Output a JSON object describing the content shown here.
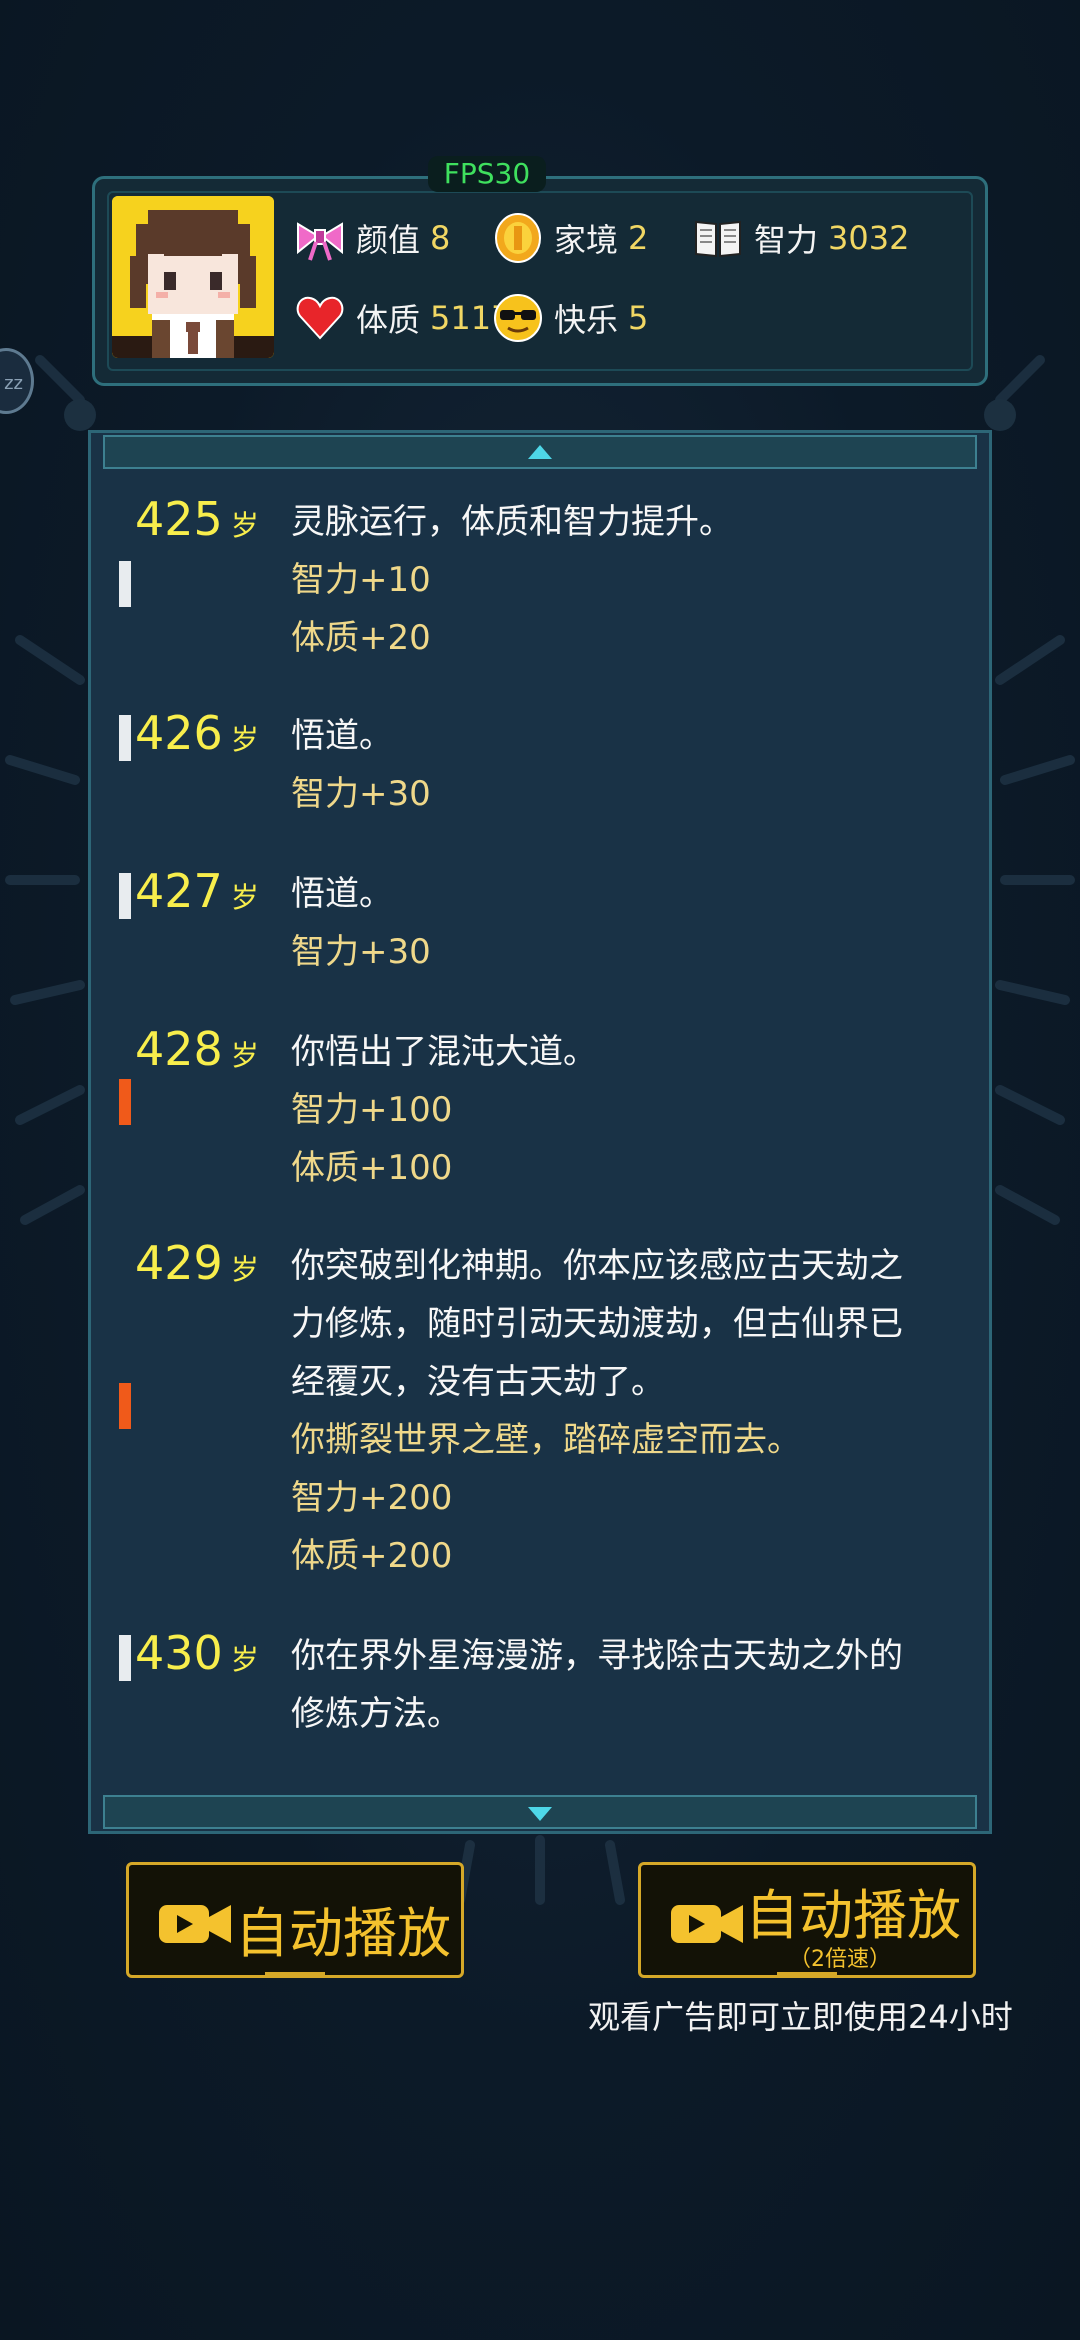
{
  "fps": "FPS30",
  "side_handle": "zz",
  "stats": [
    {
      "icon": "bow-icon",
      "label": "颜值",
      "value": "8"
    },
    {
      "icon": "coin-icon",
      "label": "家境",
      "value": "2"
    },
    {
      "icon": "book-icon",
      "label": "智力",
      "value": "3032"
    },
    {
      "icon": "heart-icon",
      "label": "体质",
      "value": "5117"
    },
    {
      "icon": "sunglasses-emoji-icon",
      "label": "快乐",
      "value": "5"
    }
  ],
  "age_suffix": "岁",
  "entries": [
    {
      "age": "425",
      "marker": "white",
      "lines": [
        {
          "text": "灵脉运行，体质和智力提升。",
          "style": "event"
        },
        {
          "text": "智力+10",
          "style": "gold"
        },
        {
          "text": "体质+20",
          "style": "gold"
        }
      ]
    },
    {
      "age": "426",
      "marker": "white",
      "lines": [
        {
          "text": "悟道。",
          "style": "event"
        },
        {
          "text": "智力+30",
          "style": "gold"
        }
      ]
    },
    {
      "age": "427",
      "marker": "white",
      "lines": [
        {
          "text": "悟道。",
          "style": "event"
        },
        {
          "text": "智力+30",
          "style": "gold"
        }
      ]
    },
    {
      "age": "428",
      "marker": "orange",
      "lines": [
        {
          "text": "你悟出了混沌大道。",
          "style": "event"
        },
        {
          "text": "智力+100",
          "style": "gold"
        },
        {
          "text": "体质+100",
          "style": "gold"
        }
      ]
    },
    {
      "age": "429",
      "marker": "orange",
      "lines": [
        {
          "text": "你突破到化神期。你本应该感应古天劫之",
          "style": "event"
        },
        {
          "text": "力修炼，随时引动天劫渡劫，但古仙界已",
          "style": "event"
        },
        {
          "text": "经覆灭，没有古天劫了。",
          "style": "event"
        },
        {
          "text": "你撕裂世界之壁，踏碎虚空而去。",
          "style": "gold"
        },
        {
          "text": "智力+200",
          "style": "gold"
        },
        {
          "text": "体质+200",
          "style": "gold"
        }
      ]
    },
    {
      "age": "430",
      "marker": "white",
      "lines": [
        {
          "text": "你在界外星海漫游，寻找除古天劫之外的",
          "style": "event"
        },
        {
          "text": "修炼方法。",
          "style": "event"
        }
      ]
    }
  ],
  "buttons": {
    "auto_play": "自动播放",
    "auto_play_2x": "自动播放",
    "auto_play_2x_sub": "（2倍速）"
  },
  "ad_note": "观看广告即可立即使用24小时",
  "colors": {
    "accent_gold": "#f4c22e",
    "age_yellow": "#f8ee4c",
    "stat_value": "#f1d764",
    "marker_orange": "#f05a1a"
  }
}
